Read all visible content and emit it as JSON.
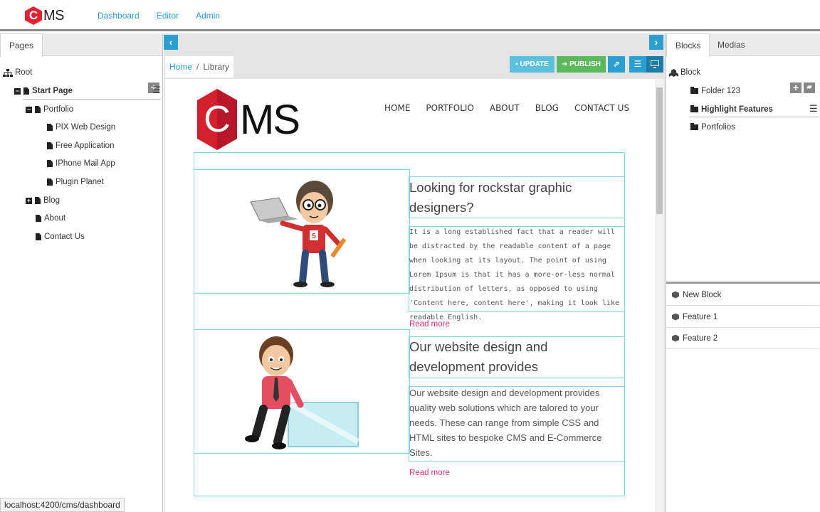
{
  "app": {
    "logo_letter": "C",
    "logo_text": "MS",
    "nav": [
      "Dashboard",
      "Editor",
      "Admin"
    ],
    "accent": "#2a9fd0"
  },
  "left_panel": {
    "tab": "Pages",
    "tree": {
      "root": "Root",
      "start_page": "Start Page",
      "portfolio": "Portfolio",
      "portfolio_items": [
        "PIX Web Design",
        "Free Application",
        "IPhone Mail App",
        "Plugin Planet"
      ],
      "blog": "Blog",
      "about": "About",
      "contact": "Contact Us"
    }
  },
  "center": {
    "breadcrumb": {
      "home": "Home",
      "sep": "/",
      "current": "Library"
    },
    "buttons": {
      "update": "UPDATE",
      "publish": "PUBLISH"
    },
    "colors": {
      "update": "#5bc0de",
      "publish": "#5cb85c",
      "blue": "#2a9fd0",
      "dark_blue": "#1b7aa6"
    },
    "site": {
      "logo_letter": "C",
      "logo_text": "MS",
      "nav": [
        "HOME",
        "PORTFOLIO",
        "ABOUT",
        "BLOG",
        "CONTACT US"
      ],
      "block1": {
        "heading": "Looking for rockstar graphic designers?",
        "body": "It is a long established fact that a reader will be distracted by the readable content of a page when looking at its layout. The point of using Lorem Ipsum is that it has a more-or-less normal distribution of letters, as opposed to using 'Content here, content here', making it look like readable English.",
        "read_more": "Read more",
        "badge": "5"
      },
      "block2": {
        "heading": "Our website design and development provides",
        "body": "Our website design and development provides quality web solutions which are talored to your needs. These can range from simple CSS and HTML sites to bespoke CMS and E-Commerce Sites.",
        "read_more": "Read more"
      }
    }
  },
  "right_panel": {
    "tabs": [
      "Blocks",
      "Medias"
    ],
    "tree": {
      "root": "Block",
      "items": [
        "Folder 123",
        "Highlight Features",
        "Portfolios"
      ]
    },
    "blocks": [
      "New Block",
      "Feature 1",
      "Feature 2"
    ]
  },
  "status_url": "localhost:4200/cms/dashboard"
}
